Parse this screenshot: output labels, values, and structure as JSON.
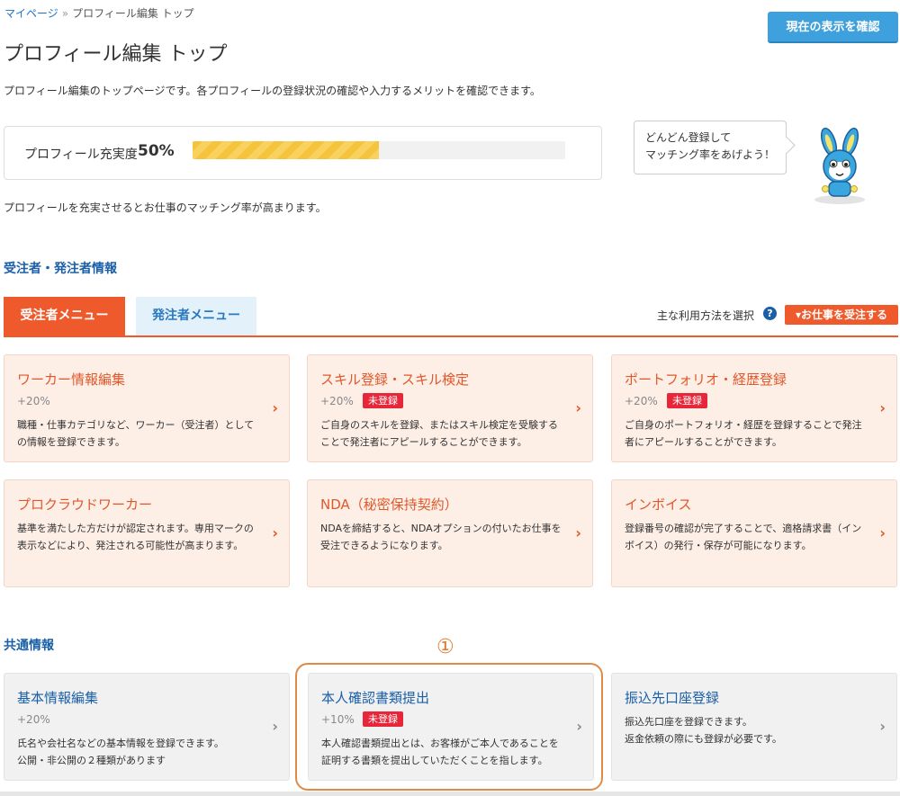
{
  "breadcrumb": {
    "home": "マイページ",
    "separator": "»",
    "current": "プロフィール編集 トップ"
  },
  "header": {
    "confirm_button": "現在の表示を確認",
    "title": "プロフィール編集 トップ"
  },
  "description": "プロフィール編集のトップページです。各プロフィールの登録状況の確認や入力するメリットを確認できます。",
  "progress": {
    "label": "プロフィール充実度",
    "value_text": "50%",
    "value": 0.5
  },
  "bubble": {
    "line1": "どんどん登録して",
    "line2": "マッチング率をあげよう！"
  },
  "fill_note": "プロフィールを充実させるとお仕事のマッチング率が高まります。",
  "section_worker": {
    "title": "受注者・発注者情報",
    "tab_active": "受注者メニュー",
    "tab_inactive": "発注者メニュー",
    "usage_label": "主な利用方法を選択",
    "help_icon": "?",
    "mode_select": "▾お仕事を受注する",
    "cards": [
      {
        "title": "ワーカー情報編集",
        "pct": "+20%",
        "badge": "",
        "desc1": "職種・仕事カテゴリなど、ワーカー（受注者）として",
        "desc2": "の情報を登録できます。"
      },
      {
        "title": "スキル登録・スキル検定",
        "pct": "+20%",
        "badge": "未登録",
        "desc1": "ご自身のスキルを登録、またはスキル検定を受験する",
        "desc2": "ことで発注者にアピールすることができます。"
      },
      {
        "title": "ポートフォリオ・経歴登録",
        "pct": "+20%",
        "badge": "未登録",
        "desc1": "ご自身のポートフォリオ・経歴を登録することで発注",
        "desc2": "者にアピールすることができます。"
      },
      {
        "title": "プロクラウドワーカー",
        "pct": "",
        "badge": "",
        "desc1": "基準を満たした方だけが認定されます。専用マークの",
        "desc2": "表示などにより、発注される可能性が高まります。"
      },
      {
        "title": "NDA（秘密保持契約）",
        "pct": "",
        "badge": "",
        "desc1": "NDAを締結すると、NDAオプションの付いたお仕事を",
        "desc2": "受注できるようになります。"
      },
      {
        "title": "インボイス",
        "pct": "",
        "badge": "",
        "desc1": "登録番号の確認が完了することで、適格請求書（イン",
        "desc2": "ボイス）の発行・保存が可能になります。"
      }
    ]
  },
  "section_common": {
    "title": "共通情報",
    "marker": "①",
    "cards": [
      {
        "title": "基本情報編集",
        "pct": "+20%",
        "badge": "",
        "desc1": "氏名や会社名などの基本情報を登録できます。",
        "desc2": "公開・非公開の２種類があります"
      },
      {
        "title": "本人確認書類提出",
        "pct": "+10%",
        "badge": "未登録",
        "desc1": "本人確認書類提出とは、お客様がご本人であることを",
        "desc2": "証明する書類を提出していただくことを指します。"
      },
      {
        "title": "振込先口座登録",
        "pct": "",
        "badge": "",
        "desc1": "振込先口座を登録できます。",
        "desc2": "返金依頼の際にも登録が必要です。"
      }
    ]
  },
  "arrow_glyph": "›"
}
